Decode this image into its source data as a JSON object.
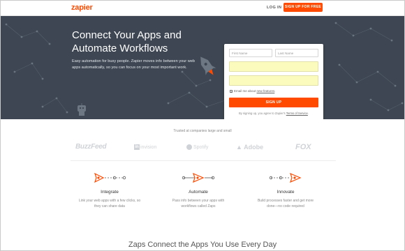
{
  "header": {
    "logo_text": "zapier",
    "login_label": "LOG IN",
    "signup_label": "SIGN UP FOR FREE"
  },
  "hero": {
    "title_line1": "Connect Your Apps and",
    "title_line2": "Automate Workflows",
    "description": "Easy automation for busy people. Zapier moves info between your web apps automatically, so you can focus on your most important work."
  },
  "form": {
    "first_name_placeholder": "First Name",
    "last_name_placeholder": "Last Name",
    "email_value": "",
    "password_value": "",
    "checkbox_checked": true,
    "checkbox_label_prefix": "Email me about ",
    "checkbox_label_link": "new features",
    "checkbox_label_suffix": ".",
    "submit_label": "SIGN UP",
    "terms_prefix": "By signing up, you agree to Zapier's ",
    "terms_link": "Terms of Service",
    "terms_suffix": "."
  },
  "trusted": {
    "caption": "Trusted at companies large and small",
    "logos": [
      "BuzzFeed",
      "invision",
      "Spotify",
      "Adobe",
      "FOX"
    ]
  },
  "features": [
    {
      "icon": "rocket-integrate-icon",
      "title": "Integrate",
      "desc_line1": "Link your web apps with a few clicks, so",
      "desc_line2": "they can share data"
    },
    {
      "icon": "rocket-automate-icon",
      "title": "Automate",
      "desc_line1": "Pass info between your apps with",
      "desc_line2": "workflows called Zaps"
    },
    {
      "icon": "rocket-innovate-icon",
      "title": "Innovate",
      "desc_line1": "Build processes faster and get more",
      "desc_line2": "done—no code required"
    }
  ],
  "bottom": {
    "title": "Zaps Connect the Apps You Use Every Day"
  },
  "colors": {
    "brand": "#ff4a00",
    "hero_bg": "#3d4652",
    "autofill_bg": "#fbfbbe"
  }
}
